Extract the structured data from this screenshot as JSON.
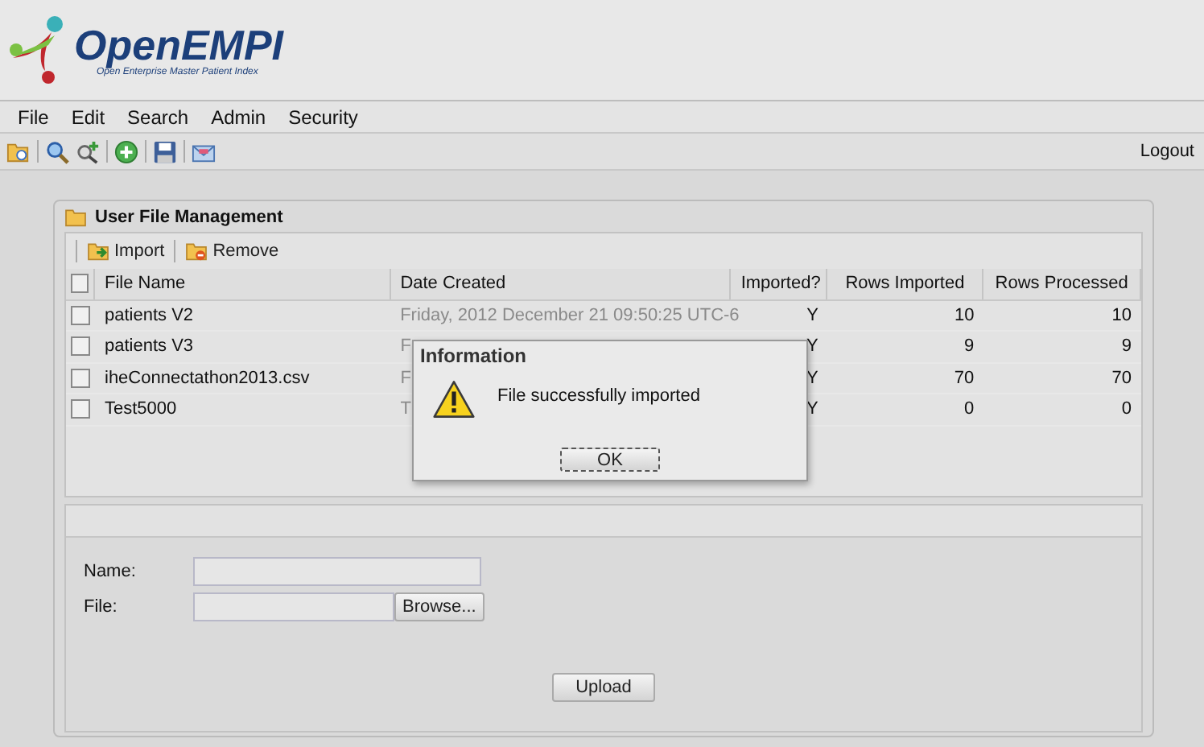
{
  "logo": {
    "name": "OpenEMPI",
    "tagline": "Open Enterprise Master Patient Index"
  },
  "menu": [
    "File",
    "Edit",
    "Search",
    "Admin",
    "Security"
  ],
  "toolbar": {
    "logout": "Logout"
  },
  "panel": {
    "title": "User File Management",
    "grid_toolbar": [
      {
        "label": "Import",
        "kind": "import"
      },
      {
        "label": "Remove",
        "kind": "remove"
      }
    ],
    "select_all": {
      "checked": false
    },
    "columns": [
      "File Name",
      "Date Created",
      "Imported?",
      "Rows Imported",
      "Rows Processed"
    ],
    "rows": [
      {
        "checked": false,
        "name": "patients V2",
        "date": "Friday, 2012 December 21 09:50:25 UTC-6",
        "imported": "Y",
        "rows_imported": "10",
        "rows_processed": "10"
      },
      {
        "checked": false,
        "name": "patients V3",
        "date": "F",
        "imported": "Y",
        "rows_imported": "9",
        "rows_processed": "9"
      },
      {
        "checked": false,
        "name": "iheConnectathon2013.csv",
        "date": "F",
        "imported": "Y",
        "rows_imported": "70",
        "rows_processed": "70"
      },
      {
        "checked": false,
        "name": "Test5000",
        "date": "T",
        "imported": "Y",
        "rows_imported": "0",
        "rows_processed": "0"
      }
    ],
    "form": {
      "name_label": "Name:",
      "file_label": "File:",
      "browse": "Browse...",
      "upload": "Upload"
    }
  },
  "dialog": {
    "title": "Information",
    "message": "File successfully imported",
    "ok": "OK"
  }
}
